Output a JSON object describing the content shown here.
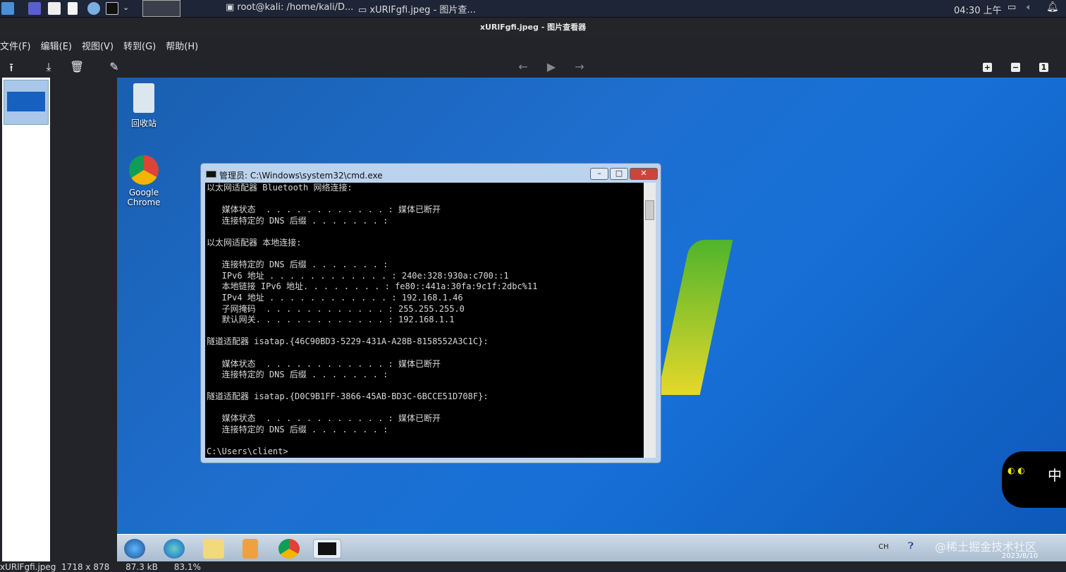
{
  "panel": {
    "tasks": [
      "root@kali: /home/kali/D...",
      "xURlFgfi.jpeg - 图片查..."
    ],
    "clock": "04:30 上午"
  },
  "window": {
    "title": "xURlFgfi.jpeg - 图片查看器"
  },
  "menu": [
    "文件(F)",
    "编辑(E)",
    "视图(V)",
    "转到(G)",
    "帮助(H)"
  ],
  "zoom_buttons": [
    "+",
    "−",
    "1"
  ],
  "desktop": {
    "icons": [
      "回收站",
      "Google\nChrome"
    ]
  },
  "cmd": {
    "title": "管理员: C:\\Windows\\system32\\cmd.exe",
    "lines": [
      "以太网适配器 Bluetooth 网络连接:",
      "",
      "   媒体状态  . . . . . . . . . . . . : 媒体已断开",
      "   连接特定的 DNS 后缀 . . . . . . . :",
      "",
      "以太网适配器 本地连接:",
      "",
      "   连接特定的 DNS 后缀 . . . . . . . :",
      "   IPv6 地址 . . . . . . . . . . . . : 240e:328:930a:c700::1",
      "   本地链接 IPv6 地址. . . . . . . . : fe80::441a:30fa:9c1f:2dbc%11",
      "   IPv4 地址 . . . . . . . . . . . . : 192.168.1.46",
      "   子网掩码  . . . . . . . . . . . . : 255.255.255.0",
      "   默认网关. . . . . . . . . . . . . : 192.168.1.1",
      "",
      "隧道适配器 isatap.{46C90BD3-5229-431A-A28B-8158552A3C1C}:",
      "",
      "   媒体状态  . . . . . . . . . . . . : 媒体已断开",
      "   连接特定的 DNS 后缀 . . . . . . . :",
      "",
      "隧道适配器 isatap.{D0C9B1FF-3866-45AB-BD3C-6BCCE51D708F}:",
      "",
      "   媒体状态  . . . . . . . . . . . . : 媒体已断开",
      "   连接特定的 DNS 后缀 . . . . . . . :",
      "",
      "C:\\Users\\client>"
    ]
  },
  "tray": {
    "lang": "CH",
    "date": "2023/8/10",
    "watermark": "@稀土掘金技术社区",
    "ime": "中"
  },
  "status": {
    "filename": "xURlFgfi.jpeg",
    "dimensions": "1718 x 878",
    "size": "87.3 kB",
    "zoom": "83.1%"
  }
}
